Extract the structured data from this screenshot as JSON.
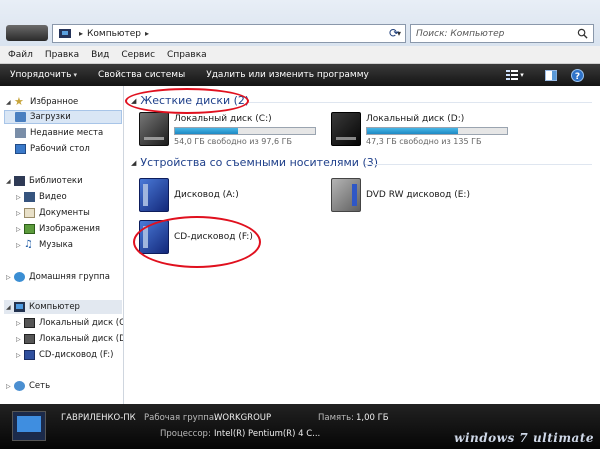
{
  "window": {
    "address": {
      "location": "Компьютер"
    },
    "search": {
      "placeholder": "Поиск: Компьютер"
    }
  },
  "menubar": [
    "Файл",
    "Правка",
    "Вид",
    "Сервис",
    "Справка"
  ],
  "commandbar": {
    "organize": "Упорядочить",
    "system_properties": "Свойства системы",
    "uninstall": "Удалить или изменить программу"
  },
  "sidebar": {
    "favorites": {
      "label": "Избранное",
      "items": [
        "Загрузки",
        "Недавние места",
        "Рабочий стол"
      ]
    },
    "libraries": {
      "label": "Библиотеки",
      "items": [
        "Видео",
        "Документы",
        "Изображения",
        "Музыка"
      ]
    },
    "homegroup": "Домашняя группа",
    "computer": {
      "label": "Компьютер",
      "items": [
        "Локальный диск (C",
        "Локальный диск (D",
        "CD-дисковод (F:)"
      ]
    },
    "network": "Сеть"
  },
  "content": {
    "hard_disks": {
      "title": "Жесткие диски (2)",
      "drives": [
        {
          "name": "Локальный диск (C:)",
          "free": "54,0 ГБ свободно из 97,6 ГБ",
          "used_fraction": 0.45
        },
        {
          "name": "Локальный диск (D:)",
          "free": "47,3 ГБ свободно из 135 ГБ",
          "used_fraction": 0.65
        }
      ]
    },
    "removable": {
      "title": "Устройства со съемными носителями (3)",
      "drives": [
        {
          "name": "Дисковод (A:)"
        },
        {
          "name": "DVD RW дисковод (E:)"
        },
        {
          "name": "CD-дисковод (F:)"
        }
      ]
    }
  },
  "details": {
    "computer_name": "ГАВРИЛЕНКО-ПК",
    "workgroup_label": "Рабочая группа:",
    "workgroup": "WORKGROUP",
    "memory_label": "Память:",
    "memory": "1,00 ГБ",
    "cpu_label": "Процессор:",
    "cpu": "Intel(R) Pentium(R) 4 C...",
    "watermark": "windows 7 ultimate"
  },
  "colors": {
    "annotation_circle": "#e0101e",
    "group_title": "#1e3f8a",
    "disk_bar_fill": "#1d89c4"
  }
}
